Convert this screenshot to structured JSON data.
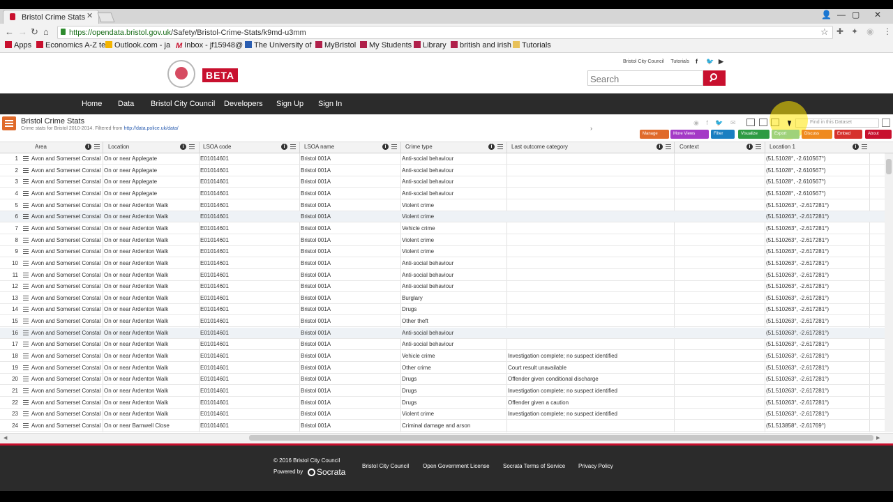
{
  "browser": {
    "tab_title": "Bristol Crime Stats",
    "url_secure": "https://opendata.bristol.gov.uk",
    "url_path": "/Safety/Bristol-Crime-Stats/k9md-u3mm",
    "bookmarks": [
      "Apps",
      "Economics A-Z te",
      "Outlook.com - ja",
      "Inbox - jf15948@",
      "The University of",
      "MyBristol",
      "My Students",
      "Library",
      "british and irish",
      "Tutorials"
    ]
  },
  "site": {
    "badge": "BETA",
    "top_links": [
      "Bristol City Council",
      "Tutorials"
    ],
    "search_placeholder": "Search",
    "nav": [
      "Home",
      "Data",
      "Bristol City Council",
      "Developers",
      "Sign Up",
      "Sign In"
    ]
  },
  "dataset": {
    "title": "Bristol Crime Stats",
    "subtitle": "Crime stats for Bristol 2010-2014. Filtered from ",
    "link": "http://data.police.uk/data/",
    "find_placeholder": "Find in this Dataset",
    "actions": [
      {
        "label": "Manage",
        "color": "#e06a2a"
      },
      {
        "label": "More Views",
        "color": "#a43ac6"
      },
      {
        "label": "Filter",
        "color": "#1a7fc1"
      },
      {
        "label": "Visualize",
        "color": "#2e9b43"
      },
      {
        "label": "Export",
        "color": "#9fd27a"
      },
      {
        "label": "Discuss",
        "color": "#ef8a1e"
      },
      {
        "label": "Embed",
        "color": "#d6312d"
      },
      {
        "label": "About",
        "color": "#c8102e"
      }
    ]
  },
  "grid": {
    "columns": [
      "Area",
      "Location",
      "LSOA code",
      "LSOA name",
      "Crime type",
      "Last outcome category",
      "Context",
      "Location 1"
    ],
    "rows": [
      [
        "1",
        "Avon and Somerset Constal",
        "On or near Applegate",
        "E01014601",
        "Bristol 001A",
        "Anti-social behaviour",
        "",
        "",
        "(51.51028°, -2.610567°)"
      ],
      [
        "2",
        "Avon and Somerset Constal",
        "On or near Applegate",
        "E01014601",
        "Bristol 001A",
        "Anti-social behaviour",
        "",
        "",
        "(51.51028°, -2.610567°)"
      ],
      [
        "3",
        "Avon and Somerset Constal",
        "On or near Applegate",
        "E01014601",
        "Bristol 001A",
        "Anti-social behaviour",
        "",
        "",
        "(51.51028°, -2.610567°)"
      ],
      [
        "4",
        "Avon and Somerset Constal",
        "On or near Applegate",
        "E01014601",
        "Bristol 001A",
        "Anti-social behaviour",
        "",
        "",
        "(51.51028°, -2.610567°)"
      ],
      [
        "5",
        "Avon and Somerset Constal",
        "On or near Ardenton Walk",
        "E01014601",
        "Bristol 001A",
        "Violent crime",
        "",
        "",
        "(51.510263°, -2.617281°)"
      ],
      [
        "6",
        "Avon and Somerset Constal",
        "On or near Ardenton Walk",
        "E01014601",
        "Bristol 001A",
        "Violent crime",
        "",
        "",
        "(51.510263°, -2.617281°)"
      ],
      [
        "7",
        "Avon and Somerset Constal",
        "On or near Ardenton Walk",
        "E01014601",
        "Bristol 001A",
        "Vehicle crime",
        "",
        "",
        "(51.510263°, -2.617281°)"
      ],
      [
        "8",
        "Avon and Somerset Constal",
        "On or near Ardenton Walk",
        "E01014601",
        "Bristol 001A",
        "Violent crime",
        "",
        "",
        "(51.510263°, -2.617281°)"
      ],
      [
        "9",
        "Avon and Somerset Constal",
        "On or near Ardenton Walk",
        "E01014601",
        "Bristol 001A",
        "Violent crime",
        "",
        "",
        "(51.510263°, -2.617281°)"
      ],
      [
        "10",
        "Avon and Somerset Constal",
        "On or near Ardenton Walk",
        "E01014601",
        "Bristol 001A",
        "Anti-social behaviour",
        "",
        "",
        "(51.510263°, -2.617281°)"
      ],
      [
        "11",
        "Avon and Somerset Constal",
        "On or near Ardenton Walk",
        "E01014601",
        "Bristol 001A",
        "Anti-social behaviour",
        "",
        "",
        "(51.510263°, -2.617281°)"
      ],
      [
        "12",
        "Avon and Somerset Constal",
        "On or near Ardenton Walk",
        "E01014601",
        "Bristol 001A",
        "Anti-social behaviour",
        "",
        "",
        "(51.510263°, -2.617281°)"
      ],
      [
        "13",
        "Avon and Somerset Constal",
        "On or near Ardenton Walk",
        "E01014601",
        "Bristol 001A",
        "Burglary",
        "",
        "",
        "(51.510263°, -2.617281°)"
      ],
      [
        "14",
        "Avon and Somerset Constal",
        "On or near Ardenton Walk",
        "E01014601",
        "Bristol 001A",
        "Drugs",
        "",
        "",
        "(51.510263°, -2.617281°)"
      ],
      [
        "15",
        "Avon and Somerset Constal",
        "On or near Ardenton Walk",
        "E01014601",
        "Bristol 001A",
        "Other theft",
        "",
        "",
        "(51.510263°, -2.617281°)"
      ],
      [
        "16",
        "Avon and Somerset Constal",
        "On or near Ardenton Walk",
        "E01014601",
        "Bristol 001A",
        "Anti-social behaviour",
        "",
        "",
        "(51.510263°, -2.617281°)"
      ],
      [
        "17",
        "Avon and Somerset Constal",
        "On or near Ardenton Walk",
        "E01014601",
        "Bristol 001A",
        "Anti-social behaviour",
        "",
        "",
        "(51.510263°, -2.617281°)"
      ],
      [
        "18",
        "Avon and Somerset Constal",
        "On or near Ardenton Walk",
        "E01014601",
        "Bristol 001A",
        "Vehicle crime",
        "Investigation complete; no suspect identified",
        "",
        "(51.510263°, -2.617281°)"
      ],
      [
        "19",
        "Avon and Somerset Constal",
        "On or near Ardenton Walk",
        "E01014601",
        "Bristol 001A",
        "Other crime",
        "Court result unavailable",
        "",
        "(51.510263°, -2.617281°)"
      ],
      [
        "20",
        "Avon and Somerset Constal",
        "On or near Ardenton Walk",
        "E01014601",
        "Bristol 001A",
        "Drugs",
        "Offender given conditional discharge",
        "",
        "(51.510263°, -2.617281°)"
      ],
      [
        "21",
        "Avon and Somerset Constal",
        "On or near Ardenton Walk",
        "E01014601",
        "Bristol 001A",
        "Drugs",
        "Investigation complete; no suspect identified",
        "",
        "(51.510263°, -2.617281°)"
      ],
      [
        "22",
        "Avon and Somerset Constal",
        "On or near Ardenton Walk",
        "E01014601",
        "Bristol 001A",
        "Drugs",
        "Offender given a caution",
        "",
        "(51.510263°, -2.617281°)"
      ],
      [
        "23",
        "Avon and Somerset Constal",
        "On or near Ardenton Walk",
        "E01014601",
        "Bristol 001A",
        "Violent crime",
        "Investigation complete; no suspect identified",
        "",
        "(51.510263°, -2.617281°)"
      ],
      [
        "24",
        "Avon and Somerset Constal",
        "On or near Barnwell Close",
        "E01014601",
        "Bristol 001A",
        "Criminal damage and arson",
        "",
        "",
        "(51.513858°, -2.61769°)"
      ]
    ]
  },
  "footer": {
    "copyright": "© 2016 Bristol City Council",
    "powered": "Powered by",
    "powered_brand": "Socrata",
    "links": [
      "Bristol City Council",
      "Open Government License",
      "Socrata Terms of Service",
      "Privacy Policy"
    ]
  }
}
